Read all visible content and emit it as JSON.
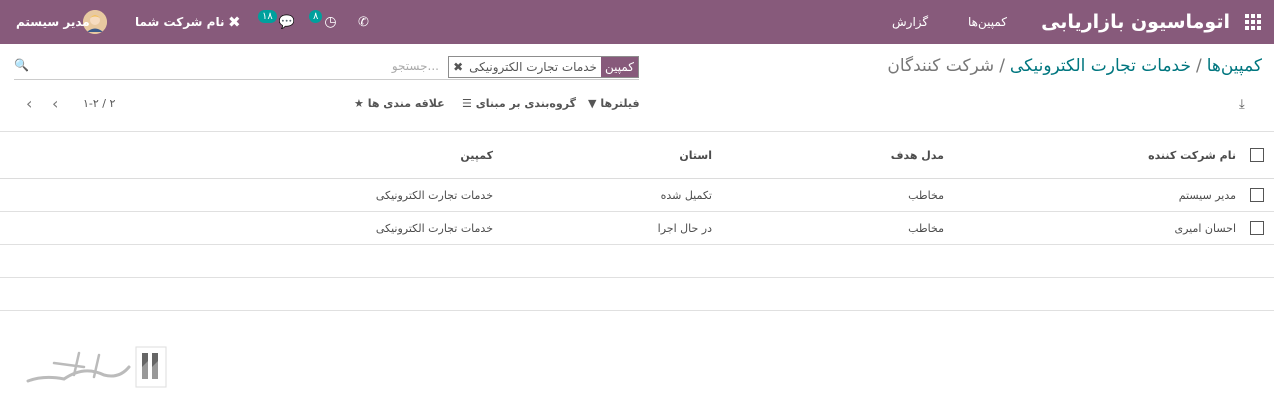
{
  "navbar": {
    "app_title": "اتوماسیون بازاریابی",
    "menus": [
      "کمپین‌ها",
      "گزارش"
    ],
    "company": "نام شرکت شما",
    "user": "مدیر سیستم",
    "chat_count": "۱۸",
    "activity_count": "۸",
    "icons": [
      "apps-icon",
      "phone-icon",
      "activity-icon",
      "chat-icon",
      "debug-icon",
      "avatar"
    ]
  },
  "breadcrumb": {
    "items": [
      "کمپین‌ها",
      "خدمات تجارت الکترونیکی"
    ],
    "separator": "/",
    "current": "شرکت کنندگان"
  },
  "search": {
    "facet_label": "کمپین",
    "facet_value": "خدمات تجارت الکترونیکی",
    "placeholder": "جستجو..."
  },
  "control_panel": {
    "filters": "فیلترها",
    "group_by": "گروه‌بندی بر مبنای",
    "favorites": "علاقه مندی ها",
    "pager": "۱-۲ / ۲"
  },
  "table": {
    "columns": [
      "نام شرکت کننده",
      "مدل هدف",
      "استان",
      "کمپین"
    ],
    "rows": [
      [
        "مدیر سیستم",
        "مخاطب",
        "تکمیل شده",
        "خدمات تجارت الکترونیکی"
      ],
      [
        "احسان امیری",
        "مخاطب",
        "در حال اجرا",
        "خدمات تجارت الکترونیکی"
      ]
    ]
  },
  "colors": {
    "brand": "#875a7b",
    "link": "#00767f",
    "badge": "#00a09d"
  }
}
